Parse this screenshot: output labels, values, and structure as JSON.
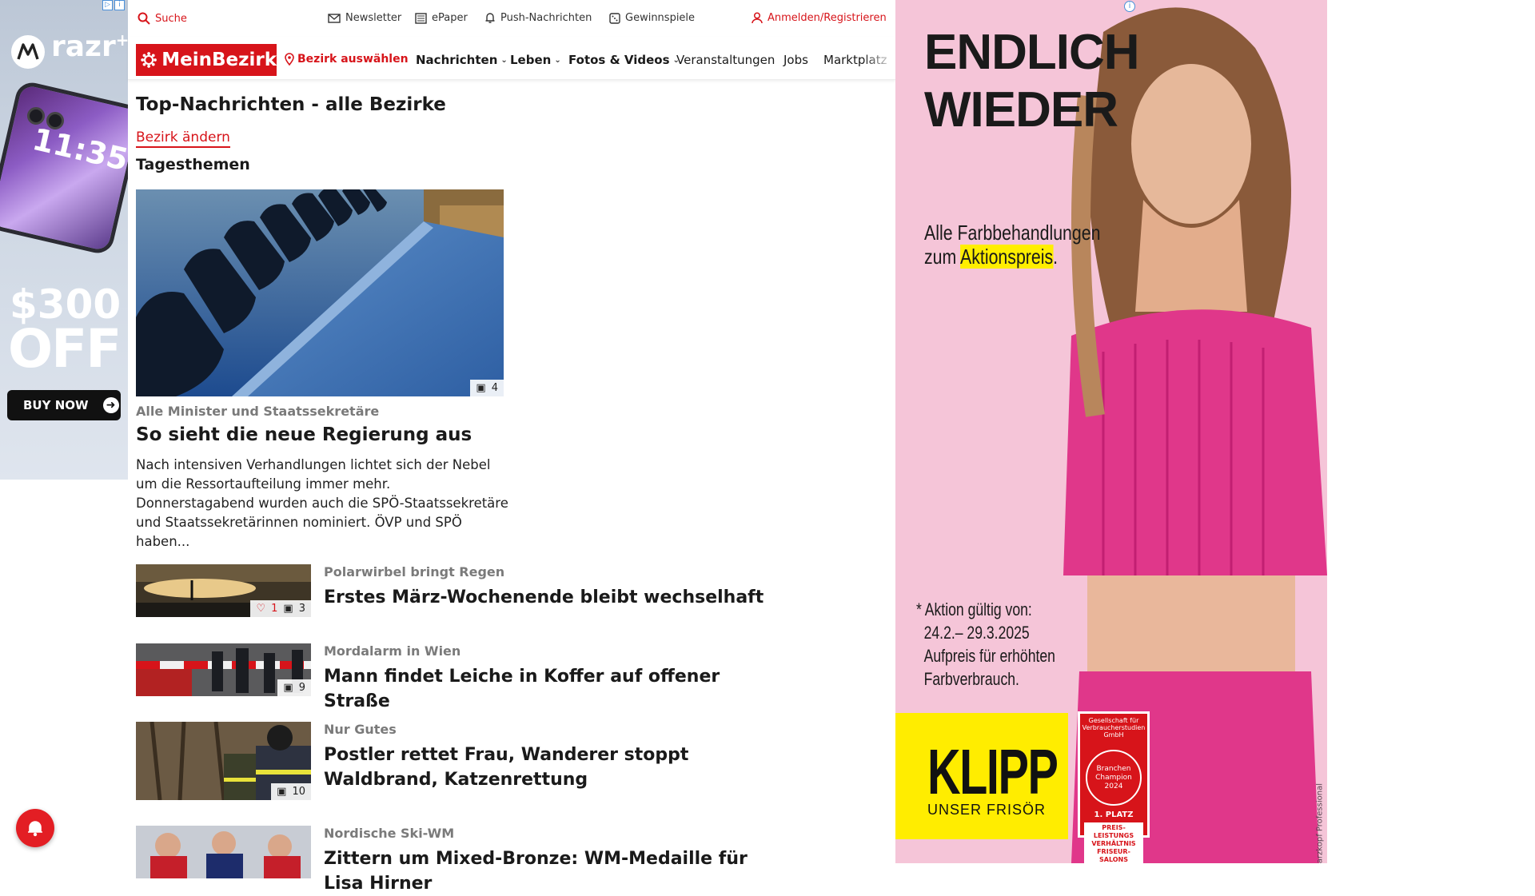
{
  "left_ad": {
    "brand": "razr",
    "brand_sup": "+",
    "phone_time": "11:35",
    "price": "$300",
    "off": "OFF",
    "cta": "BUY NOW"
  },
  "topbar": {
    "search": "Suche",
    "newsletter": "Newsletter",
    "epaper": "ePaper",
    "push": "Push-Nachrichten",
    "gewinnspiele": "Gewinnspiele",
    "login": "Anmelden/Registrieren"
  },
  "nav": {
    "logo": "MeinBezirk",
    "bezirk": "Bezirk auswählen",
    "items": [
      "Nachrichten",
      "Leben",
      "Fotos & Videos",
      "Veranstaltungen",
      "Jobs",
      "Marktplatz"
    ]
  },
  "page": {
    "title": "Top-Nachrichten - alle Bezirke",
    "change_bezirk": "Bezirk ändern",
    "section": "Tagesthemen"
  },
  "hero": {
    "image_count": "4",
    "kicker": "Alle Minister und Staatssekretäre",
    "headline": "So sieht die neue Regierung aus",
    "teaser": "Nach intensiven Verhandlungen lichtet sich der Nebel um die Ressortaufteilung immer mehr. Donnerstagabend wurden auch die SPÖ-Staatssekretäre und Staatssekretärinnen nominiert. ÖVP und SPÖ haben..."
  },
  "articles": [
    {
      "kicker": "Polarwirbel bringt Regen",
      "headline": "Erstes März-Wochenende bleibt wechselhaft",
      "likes": "1",
      "images": "3"
    },
    {
      "kicker": "Mordalarm in Wien",
      "headline": "Mann findet Leiche in Koffer auf offener Straße",
      "likes": "",
      "images": "9"
    },
    {
      "kicker": "Nur Gutes",
      "headline": "Postler rettet Frau, Wanderer stoppt Waldbrand, Katzenrettung",
      "likes": "",
      "images": "10"
    },
    {
      "kicker": "Nordische Ski-WM",
      "headline": "Zittern um Mixed-Bronze: WM-Medaille für Lisa Hirner",
      "likes": "",
      "images": ""
    }
  ],
  "right_ad": {
    "headline_1": "ENDLICH",
    "headline_2": "WIEDER",
    "sub_1": "Alle Farbbehandlungen",
    "sub_2a": "zum ",
    "sub_2b": "Aktionspreis",
    "sub_2c": ".",
    "terms_1": "* Aktion gültig von:",
    "terms_2": "24.2.– 29.3.2025",
    "terms_3": "Aufpreis für erhöhten",
    "terms_4": "Farbverbrauch.",
    "brand": "KLIPP",
    "brand_tag": "UNSER FRISÖR",
    "seal_top": "Gesellschaft für Verbraucherstudien GmbH",
    "seal_circle": "Branchen Champion 2024",
    "seal_place": "1. PLATZ",
    "seal_award": "PREIS-LEISTUNGS VERHÄLTNIS FRISEUR-SALONS",
    "credit": "Foto: Schwarzkopf Professional"
  },
  "colors": {
    "brand_red": "#d7141a",
    "ad_pink": "#f5c5d8",
    "klipp_yellow": "#ffed00"
  }
}
